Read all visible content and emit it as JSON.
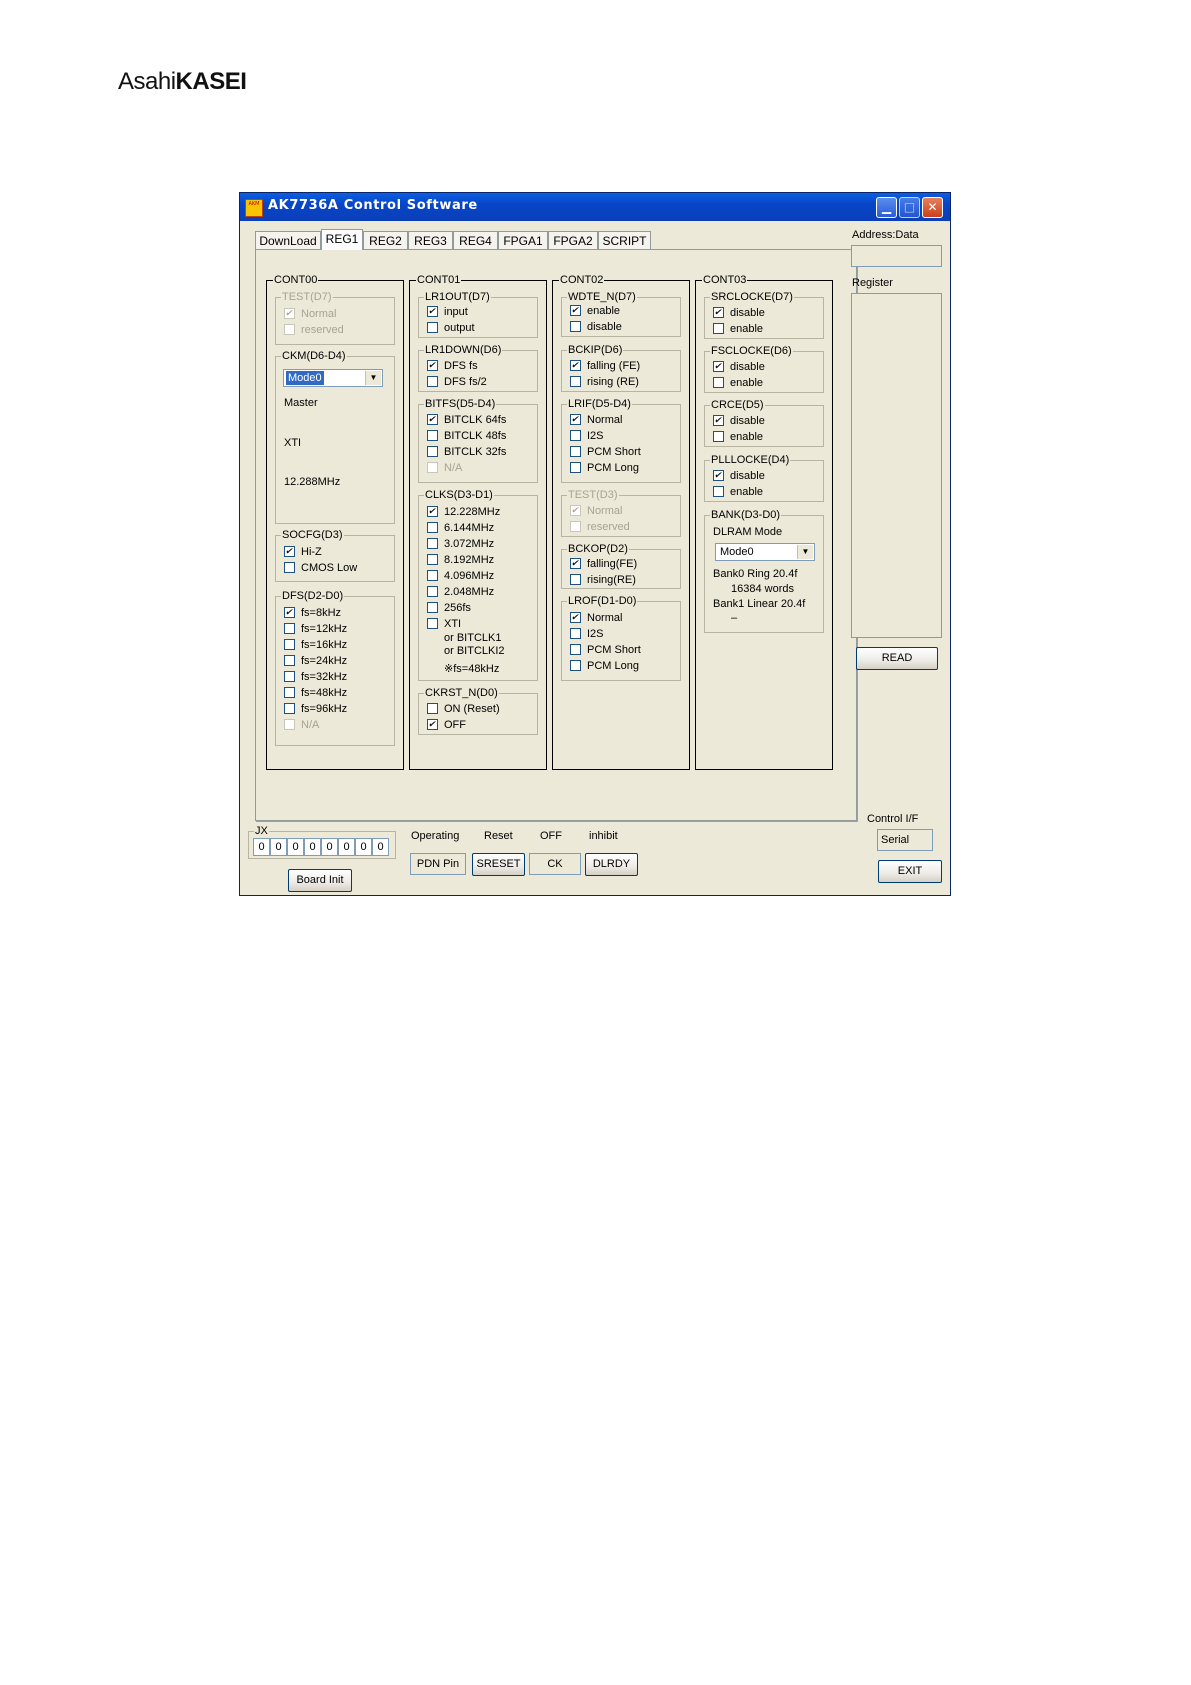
{
  "logo": {
    "part1": "Asahi",
    "part2": "KASEI"
  },
  "window": {
    "title": "AK7736A Control Software",
    "icon_text": "AKM"
  },
  "tabs": [
    "DownLoad",
    "REG1",
    "REG2",
    "REG3",
    "REG4",
    "FPGA1",
    "FPGA2",
    "SCRIPT"
  ],
  "cont00": {
    "title": "CONT00",
    "test": {
      "title": "TEST(D7)",
      "opts": [
        "Normal",
        "reserved"
      ]
    },
    "ckm": {
      "title": "CKM(D6-D4)",
      "value": "Mode0",
      "info1": "Master",
      "info2": "XTI",
      "info3": "12.288MHz"
    },
    "socfg": {
      "title": "SOCFG(D3)",
      "opts": [
        "Hi-Z",
        "CMOS Low"
      ]
    },
    "dfs": {
      "title": "DFS(D2-D0)",
      "opts": [
        "fs=8kHz",
        "fs=12kHz",
        "fs=16kHz",
        "fs=24kHz",
        "fs=32kHz",
        "fs=48kHz",
        "fs=96kHz",
        "N/A"
      ]
    }
  },
  "cont01": {
    "title": "CONT01",
    "lr1out": {
      "title": "LR1OUT(D7)",
      "opts": [
        "input",
        "output"
      ]
    },
    "lr1down": {
      "title": "LR1DOWN(D6)",
      "opts": [
        "DFS fs",
        "DFS fs/2"
      ]
    },
    "bitfs": {
      "title": "BITFS(D5-D4)",
      "opts": [
        "BITCLK 64fs",
        "BITCLK 48fs",
        "BITCLK 32fs",
        "N/A"
      ]
    },
    "clks": {
      "title": "CLKS(D3-D1)",
      "opts": [
        "12.228MHz",
        "6.144MHz",
        "3.072MHz",
        "8.192MHz",
        "4.096MHz",
        "2.048MHz",
        "256fs",
        "XTI"
      ],
      "or1": "or BITCLK1",
      "or2": "or BITCLKI2",
      "note": "※fs=48kHz"
    },
    "ckrst": {
      "title": "CKRST_N(D0)",
      "opts": [
        "ON (Reset)",
        "OFF"
      ]
    }
  },
  "cont02": {
    "title": "CONT02",
    "wdte": {
      "title": "WDTE_N(D7)",
      "opts": [
        "enable",
        "disable"
      ]
    },
    "bckip": {
      "title": "BCKIP(D6)",
      "opts": [
        "falling (FE)",
        "rising (RE)"
      ]
    },
    "lrif": {
      "title": "LRIF(D5-D4)",
      "opts": [
        "Normal",
        "I2S",
        "PCM Short",
        "PCM Long"
      ]
    },
    "test": {
      "title": "TEST(D3)",
      "opts": [
        "Normal",
        "reserved"
      ]
    },
    "bckop": {
      "title": "BCKOP(D2)",
      "opts": [
        "falling(FE)",
        "rising(RE)"
      ]
    },
    "lrof": {
      "title": "LROF(D1-D0)",
      "opts": [
        "Normal",
        "I2S",
        "PCM Short",
        "PCM Long"
      ]
    }
  },
  "cont03": {
    "title": "CONT03",
    "srclocke": {
      "title": "SRCLOCKE(D7)",
      "opts": [
        "disable",
        "enable"
      ]
    },
    "fsclocke": {
      "title": "FSCLOCKE(D6)",
      "opts": [
        "disable",
        "enable"
      ]
    },
    "crce": {
      "title": "CRCE(D5)",
      "opts": [
        "disable",
        "enable"
      ]
    },
    "plllocke": {
      "title": "PLLLOCKE(D4)",
      "opts": [
        "disable",
        "enable"
      ]
    },
    "bank": {
      "title": "BANK(D3-D0)",
      "mode_label": "DLRAM Mode",
      "value": "Mode0",
      "l1": "Bank0  Ring 20.4f",
      "l2": "16384 words",
      "l3": "Bank1  Linear 20.4f",
      "l4": "–"
    }
  },
  "right": {
    "addr_label": "Address:Data",
    "reg_label": "Register",
    "read": "READ",
    "ctrl_label": "Control I/F",
    "ctrl_value": "Serial",
    "exit": "EXIT"
  },
  "bottom": {
    "jx_label": "JX",
    "jx": [
      "0",
      "0",
      "0",
      "0",
      "0",
      "0",
      "0",
      "0"
    ],
    "board_init": "Board Init",
    "status": [
      "Operating",
      "Reset",
      "OFF",
      "inhibit"
    ],
    "pdn": "PDN Pin",
    "sreset": "SRESET",
    "ck": "CK",
    "dlrdy": "DLRDY"
  }
}
